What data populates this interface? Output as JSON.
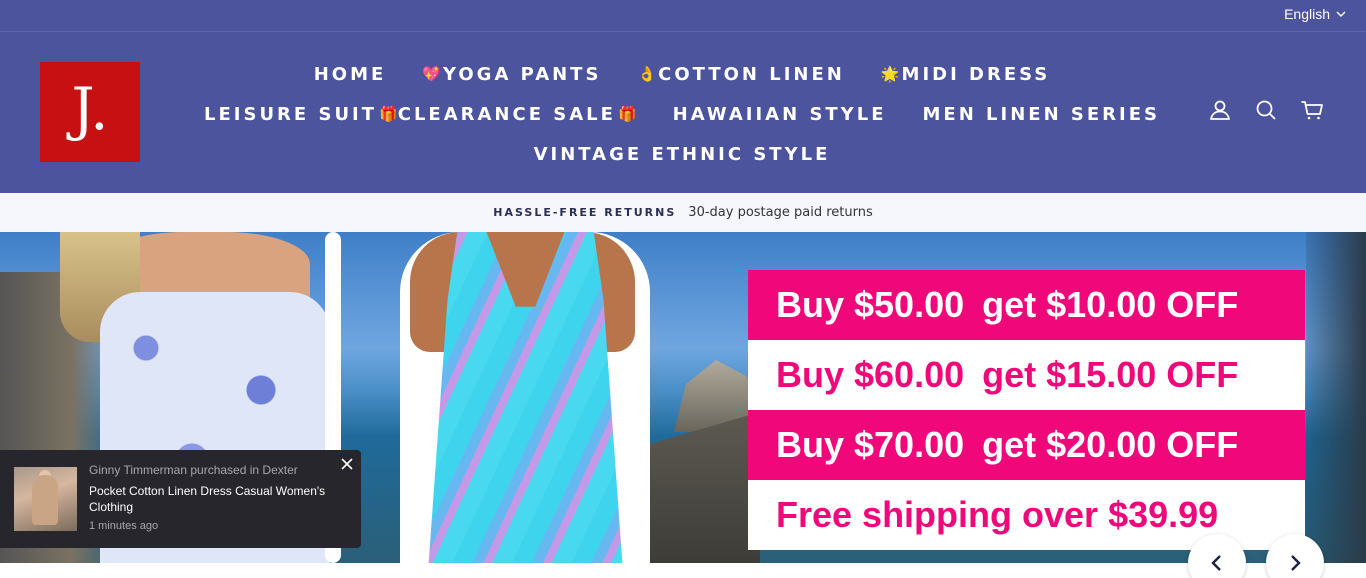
{
  "topbar": {
    "language": "English"
  },
  "logo": {
    "text": "J."
  },
  "nav": {
    "row1": [
      {
        "label": "HOME",
        "emoji": ""
      },
      {
        "label": "YOGA PANTS",
        "emoji": "💖"
      },
      {
        "label": "COTTON LINEN",
        "emoji": "👌"
      },
      {
        "label": "MIDI DRESS",
        "emoji": "🌟"
      }
    ],
    "row2": [
      {
        "label": "LEISURE SUIT",
        "emoji_after": "🎁"
      },
      {
        "label": "CLEARANCE SALE",
        "emoji_after": "🎁"
      },
      {
        "label": "HAWAIIAN STYLE",
        "emoji_after": ""
      },
      {
        "label": "MEN LINEN SERIES",
        "emoji_after": ""
      }
    ],
    "row3": [
      {
        "label": "VINTAGE ETHNIC STYLE"
      }
    ]
  },
  "header_icons": [
    "account-icon",
    "search-icon",
    "cart-icon"
  ],
  "announcement": {
    "title": "HASSLE-FREE RETURNS",
    "text": "30-day postage paid returns"
  },
  "hero": {
    "promo": [
      {
        "buy": "Buy $50.00",
        "get": "get $10.00 OFF"
      },
      {
        "buy": "Buy $60.00",
        "get": "get $15.00 OFF"
      },
      {
        "buy": "Buy $70.00",
        "get": "get $20.00 OFF"
      }
    ],
    "shipping": "Free shipping over $39.99"
  },
  "popup": {
    "who": "Ginny Timmerman purchased in Dexter",
    "product": "Pocket Cotton Linen Dress Casual Women's Clothing",
    "time": "1 minutes ago"
  },
  "colors": {
    "header_bg": "#4c549e",
    "logo_bg": "#c71011",
    "promo_pink": "#f0087a",
    "popup_bg": "#26262c"
  }
}
